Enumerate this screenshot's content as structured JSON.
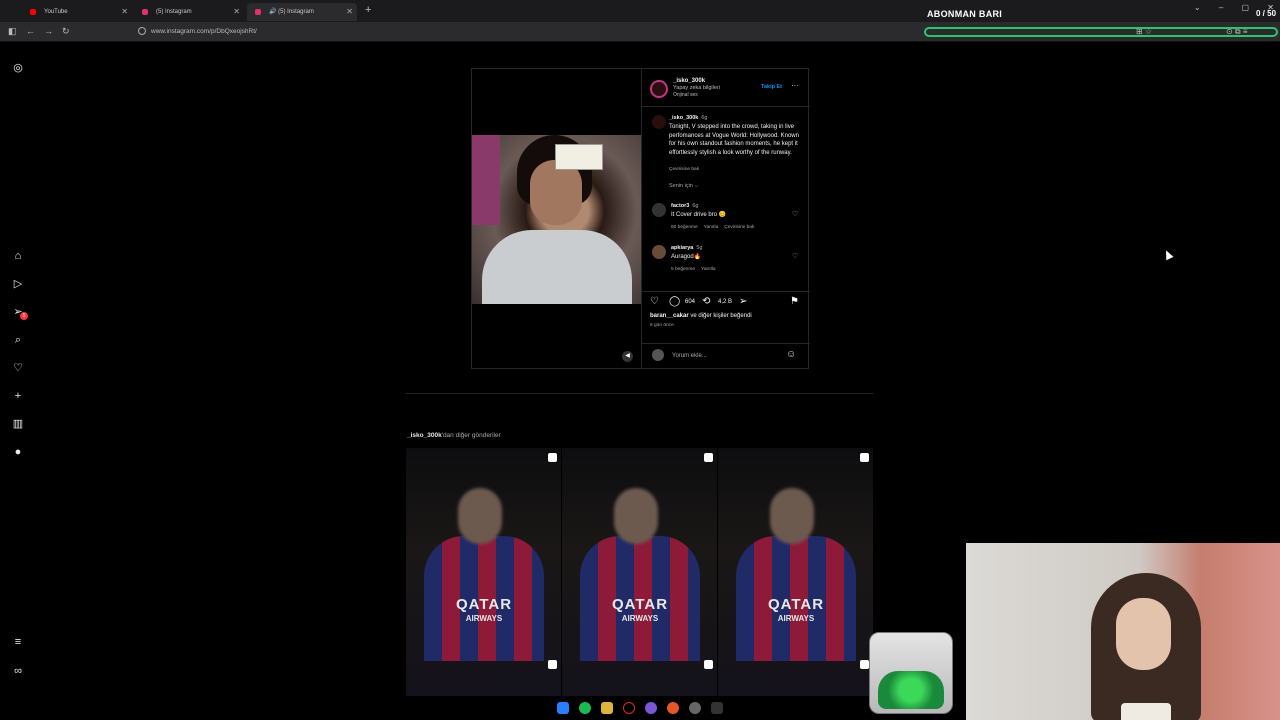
{
  "browser": {
    "tabs": [
      {
        "label": "YouTube",
        "fav_color": "#ff0000"
      },
      {
        "label": "(5) Instagram",
        "fav_color": "#e1306c"
      },
      {
        "label": "(5) Instagram",
        "fav_color": "#e1306c",
        "audio": "🔊"
      }
    ],
    "new_tab": "+",
    "url": "www.instagram.com/p/DbQxeojshRt/"
  },
  "overlay": {
    "sub_title": "ABONMAN BARI",
    "sub_count": "0 / 50",
    "sub_progress": 0,
    "accent": "#28c76f"
  },
  "post": {
    "username": "_isko_300k",
    "subtitle": "Yapay zeka bilgileri",
    "audio": "Orijinal ses",
    "follow": "Takip Et",
    "caption_user": "_isko_300k",
    "caption_time": "6g",
    "caption": "Tonight, V stepped into the crowd, taking in live perfomances at Vogue World: Hollywood. Known for his own standout fashion moments, he kept it effortlessly stylish a look worthy of the runway.",
    "caption_translate": "Çevirisine bak",
    "for_you": "Senin için ⌵",
    "comments": [
      {
        "user": "factor3",
        "time": "6g",
        "text": "It Cover drive bro 😊",
        "likes": "60 beğenme",
        "reply": "Yanıtla",
        "translate": "Çevirisine bak"
      },
      {
        "user": "apkiarya",
        "time": "5g",
        "text": "Auragod🔥",
        "likes": "5 beğenme",
        "reply": "Yanıtla"
      }
    ],
    "comment_count": "604",
    "repost_count": "4,2 B",
    "liked_by_user": "baran__cakar",
    "liked_by_rest": " ve diğer kişiler beğendi",
    "ago": "6 gün önce",
    "comment_placeholder": "Yorum ekle..."
  },
  "more_posts": {
    "user": "_isko_300k",
    "suffix": "'dan diğer gönderiler",
    "thumbs": [
      {
        "sponsor": "QATAR",
        "sponsor2": "AIRWAYS"
      },
      {
        "sponsor": "QATAR",
        "sponsor2": "AIRWAYS"
      },
      {
        "sponsor": "QATAR",
        "sponsor2": "AIRWAYS"
      }
    ]
  },
  "rail": {
    "icons": [
      "instagram-logo-icon",
      "home-icon",
      "reels-icon",
      "messages-icon",
      "search-icon",
      "notifications-icon",
      "create-icon",
      "dashboard-icon",
      "profile-icon",
      "menu-icon",
      "meta-icon"
    ],
    "badge": "5"
  }
}
